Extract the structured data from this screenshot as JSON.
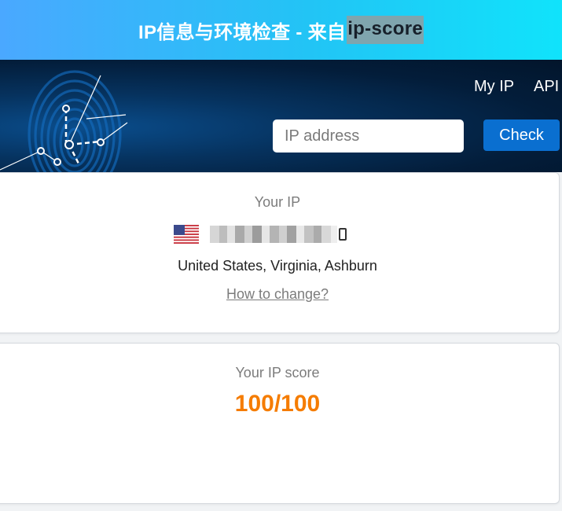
{
  "banner": {
    "title_prefix": "IP信息与环境检查 - 来自",
    "title_highlight": "ip-score",
    "bg_gradient": [
      "#4aa8ff",
      "#10e3fb"
    ]
  },
  "nav": {
    "my_ip": "My IP",
    "api": "API"
  },
  "search": {
    "placeholder": "IP address",
    "value": "",
    "button_label": "Check",
    "button_color": "#0a6fd0"
  },
  "ip_card": {
    "label": "Your IP",
    "flag_icon": "us-flag-icon",
    "ip_value": "masked",
    "location": "United States, Virginia, Ashburn",
    "change_link": "How to change?"
  },
  "score_card": {
    "label": "Your IP score",
    "score": "100/100",
    "score_color": "#f57c00"
  }
}
